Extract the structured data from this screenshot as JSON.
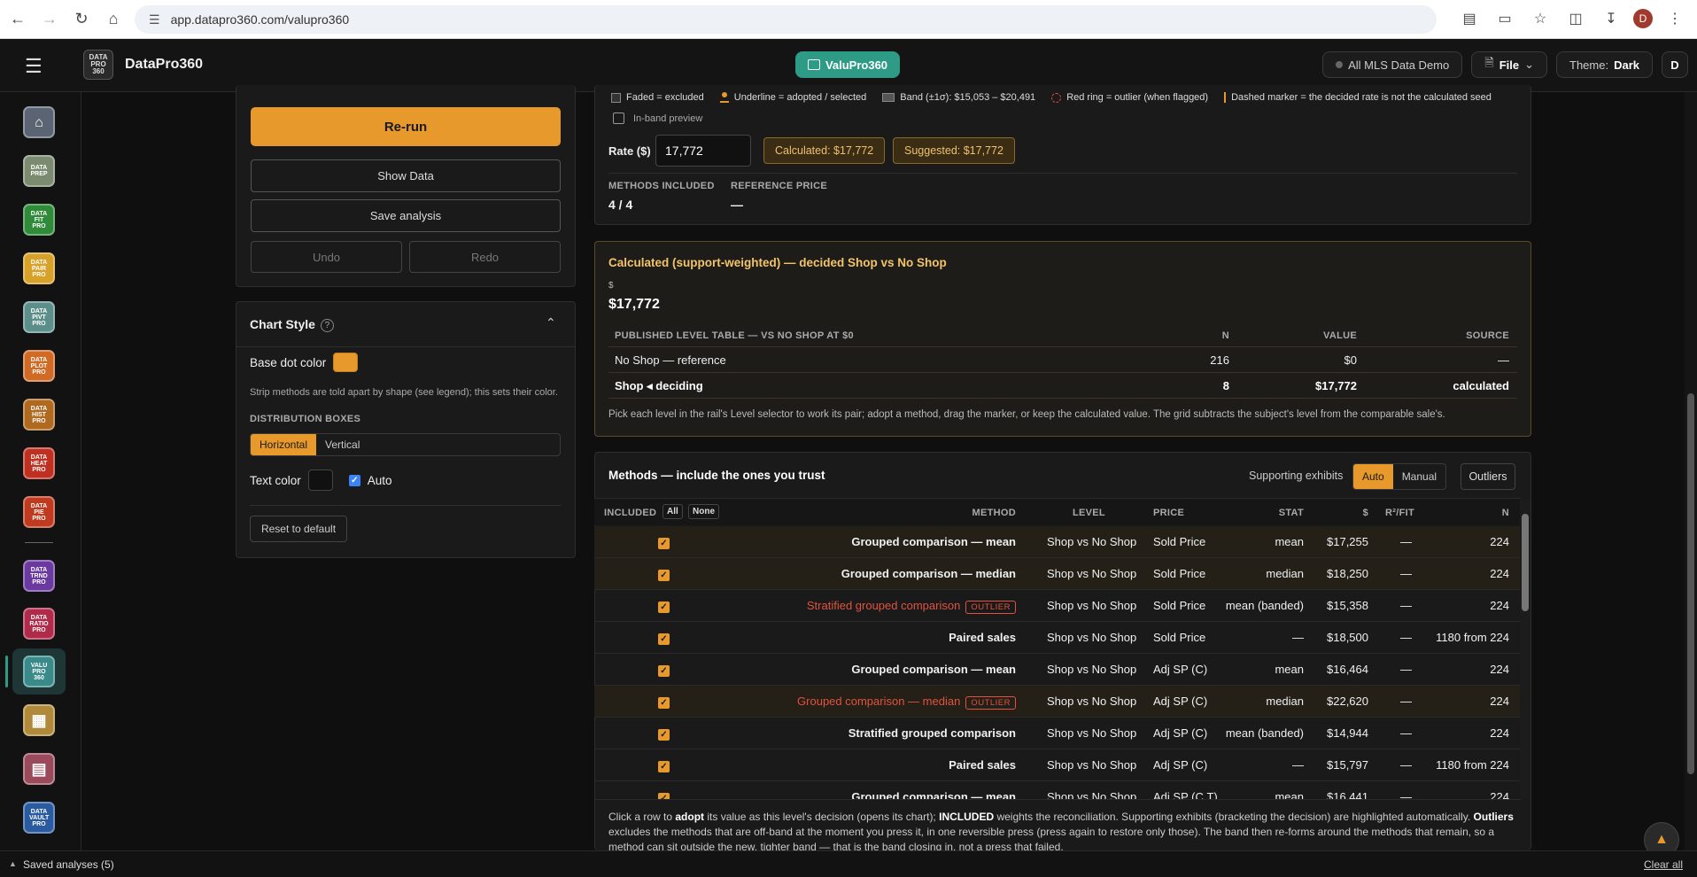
{
  "browser": {
    "url": "app.datapro360.com/valupro360"
  },
  "appbar": {
    "brand": "DataPro360",
    "logo_text": "DATA PRO 360",
    "center_pill": "ValuPro360",
    "mls": "All MLS Data Demo",
    "file": "File",
    "theme_label": "Theme:",
    "theme_value": "Dark",
    "avatar": "D"
  },
  "rail": {
    "items": [
      {
        "name": "home",
        "label": "",
        "color": "#5a6472"
      },
      {
        "name": "data-prep",
        "label": "DATA PREP",
        "color": "#7b8b70"
      },
      {
        "name": "data-fit-pro",
        "label": "DATA FIT PRO",
        "color": "#2f8b3a"
      },
      {
        "name": "data-pair-pro",
        "label": "DATA PAIR PRO",
        "color": "#d8a22a"
      },
      {
        "name": "data-pivt-pro",
        "label": "DATA PIVT PRO",
        "color": "#5d8f8a"
      },
      {
        "name": "data-plot-pro",
        "label": "DATA PLOT PRO",
        "color": "#d06a25"
      },
      {
        "name": "data-hist-pro",
        "label": "DATA HIST PRO",
        "color": "#b06a20"
      },
      {
        "name": "data-heat-pro",
        "label": "DATA HEAT PRO",
        "color": "#c03020"
      },
      {
        "name": "data-pie-pro",
        "label": "DATA PIE PRO",
        "color": "#c03a20"
      },
      {
        "name": "data-trnd-pro",
        "label": "DATA TRND PRO",
        "color": "#6b3aa0"
      },
      {
        "name": "data-ratio-pro",
        "label": "DATA RATIO PRO",
        "color": "#b02a4a"
      },
      {
        "name": "valu-pro-360",
        "label": "VALU PRO 360",
        "color": "#3a8a8a"
      },
      {
        "name": "grid-app",
        "label": "",
        "color": "#b08a3a"
      },
      {
        "name": "report-app",
        "label": "",
        "color": "#9a4a5a"
      },
      {
        "name": "data-vault-pro",
        "label": "DATA VAULT PRO",
        "color": "#2a5aa0"
      }
    ]
  },
  "left_panel": {
    "rerun": "Re-run",
    "show_data": "Show Data",
    "save_analysis": "Save analysis",
    "undo": "Undo",
    "redo": "Redo"
  },
  "chart_style": {
    "title": "Chart Style",
    "help": "?",
    "base_dot_label": "Base dot color",
    "base_dot_color": "#e8992b",
    "hint": "Strip methods are told apart by shape (see legend); this sets their color.",
    "dist_boxes": "DISTRIBUTION BOXES",
    "horizontal": "Horizontal",
    "vertical": "Vertical",
    "text_color": "Text color",
    "auto": "Auto",
    "reset": "Reset to default"
  },
  "legend": {
    "faded": "Faded = excluded",
    "underline": "Underline = adopted / selected",
    "band": "Band (±1σ): $15,053 – $20,491",
    "ring": "Red ring = outlier (when flagged)",
    "dashed": "Dashed marker = the decided rate is not the calculated seed",
    "inband": "In-band preview"
  },
  "rate": {
    "label": "Rate ($)",
    "value": "17,772",
    "calculated": "Calculated: $17,772",
    "suggested": "Suggested: $17,772"
  },
  "summary": {
    "methods_label": "METHODS INCLUDED",
    "methods_value": "4 / 4",
    "ref_label": "REFERENCE PRICE",
    "ref_value": "—"
  },
  "calculated_card": {
    "title": "Calculated (support-weighted) — decided Shop vs No Shop",
    "currency": "$",
    "value": "$17,772",
    "table_title": "PUBLISHED LEVEL TABLE — VS NO SHOP AT $0",
    "col_n": "N",
    "col_value": "VALUE",
    "col_source": "SOURCE",
    "rows": [
      {
        "level": "No Shop — reference",
        "n": "216",
        "value": "$0",
        "source": "—"
      },
      {
        "level": "Shop ◂ deciding",
        "n": "8",
        "value": "$17,772",
        "source": "calculated"
      }
    ],
    "note": "Pick each level in the rail's Level selector to work its pair; adopt a method, drag the marker, or keep the calculated value. The grid subtracts the subject's level from the comparable sale's."
  },
  "methods": {
    "title": "Methods — include the ones you trust",
    "supporting": "Supporting exhibits",
    "auto": "Auto",
    "manual": "Manual",
    "outliers": "Outliers",
    "headers": {
      "included": "INCLUDED",
      "all": "All",
      "none": "None",
      "method": "METHOD",
      "level": "LEVEL",
      "price": "PRICE",
      "stat": "STAT",
      "dollar": "$",
      "r2": "R²/FIT",
      "n": "N"
    },
    "outlier_tag": "OUTLIER",
    "rows": [
      {
        "method": "Grouped comparison — mean",
        "outlier": false,
        "level": "Shop vs No Shop",
        "price": "Sold Price",
        "stat": "mean",
        "value": "$17,255",
        "r2": "—",
        "n": "224"
      },
      {
        "method": "Grouped comparison — median",
        "outlier": false,
        "level": "Shop vs No Shop",
        "price": "Sold Price",
        "stat": "median",
        "value": "$18,250",
        "r2": "—",
        "n": "224"
      },
      {
        "method": "Stratified grouped comparison",
        "outlier": true,
        "level": "Shop vs No Shop",
        "price": "Sold Price",
        "stat": "mean (banded)",
        "value": "$15,358",
        "r2": "—",
        "n": "224"
      },
      {
        "method": "Paired sales",
        "outlier": false,
        "level": "Shop vs No Shop",
        "price": "Sold Price",
        "stat": "—",
        "value": "$18,500",
        "r2": "—",
        "n": "1180 from 224"
      },
      {
        "method": "Grouped comparison — mean",
        "outlier": false,
        "level": "Shop vs No Shop",
        "price": "Adj SP (C)",
        "stat": "mean",
        "value": "$16,464",
        "r2": "—",
        "n": "224"
      },
      {
        "method": "Grouped comparison — median",
        "outlier": true,
        "level": "Shop vs No Shop",
        "price": "Adj SP (C)",
        "stat": "median",
        "value": "$22,620",
        "r2": "—",
        "n": "224"
      },
      {
        "method": "Stratified grouped comparison",
        "outlier": false,
        "level": "Shop vs No Shop",
        "price": "Adj SP (C)",
        "stat": "mean (banded)",
        "value": "$14,944",
        "r2": "—",
        "n": "224"
      },
      {
        "method": "Paired sales",
        "outlier": false,
        "level": "Shop vs No Shop",
        "price": "Adj SP (C)",
        "stat": "—",
        "value": "$15,797",
        "r2": "—",
        "n": "1180 from 224"
      },
      {
        "method": "Grouped comparison — mean",
        "outlier": false,
        "level": "Shop vs No Shop",
        "price": "Adj SP (C,T)",
        "stat": "mean",
        "value": "$16,441",
        "r2": "—",
        "n": "224"
      }
    ],
    "foot_note_parts": [
      "Click a row to ",
      "adopt",
      " its value as this level's decision (opens its chart); ",
      "INCLUDED",
      " weights the reconciliation. Supporting exhibits (bracketing the decision) are highlighted automatically. ",
      "Outliers",
      " excludes the methods that are off-band at the moment you press it, in one reversible press (press again to restore only those). The band then re-forms around the methods that remain, so a method can sit outside the new, tighter band — that is the band closing in, not a press that failed."
    ]
  },
  "footer": {
    "saved": "Saved analyses (5)",
    "clear": "Clear all"
  }
}
